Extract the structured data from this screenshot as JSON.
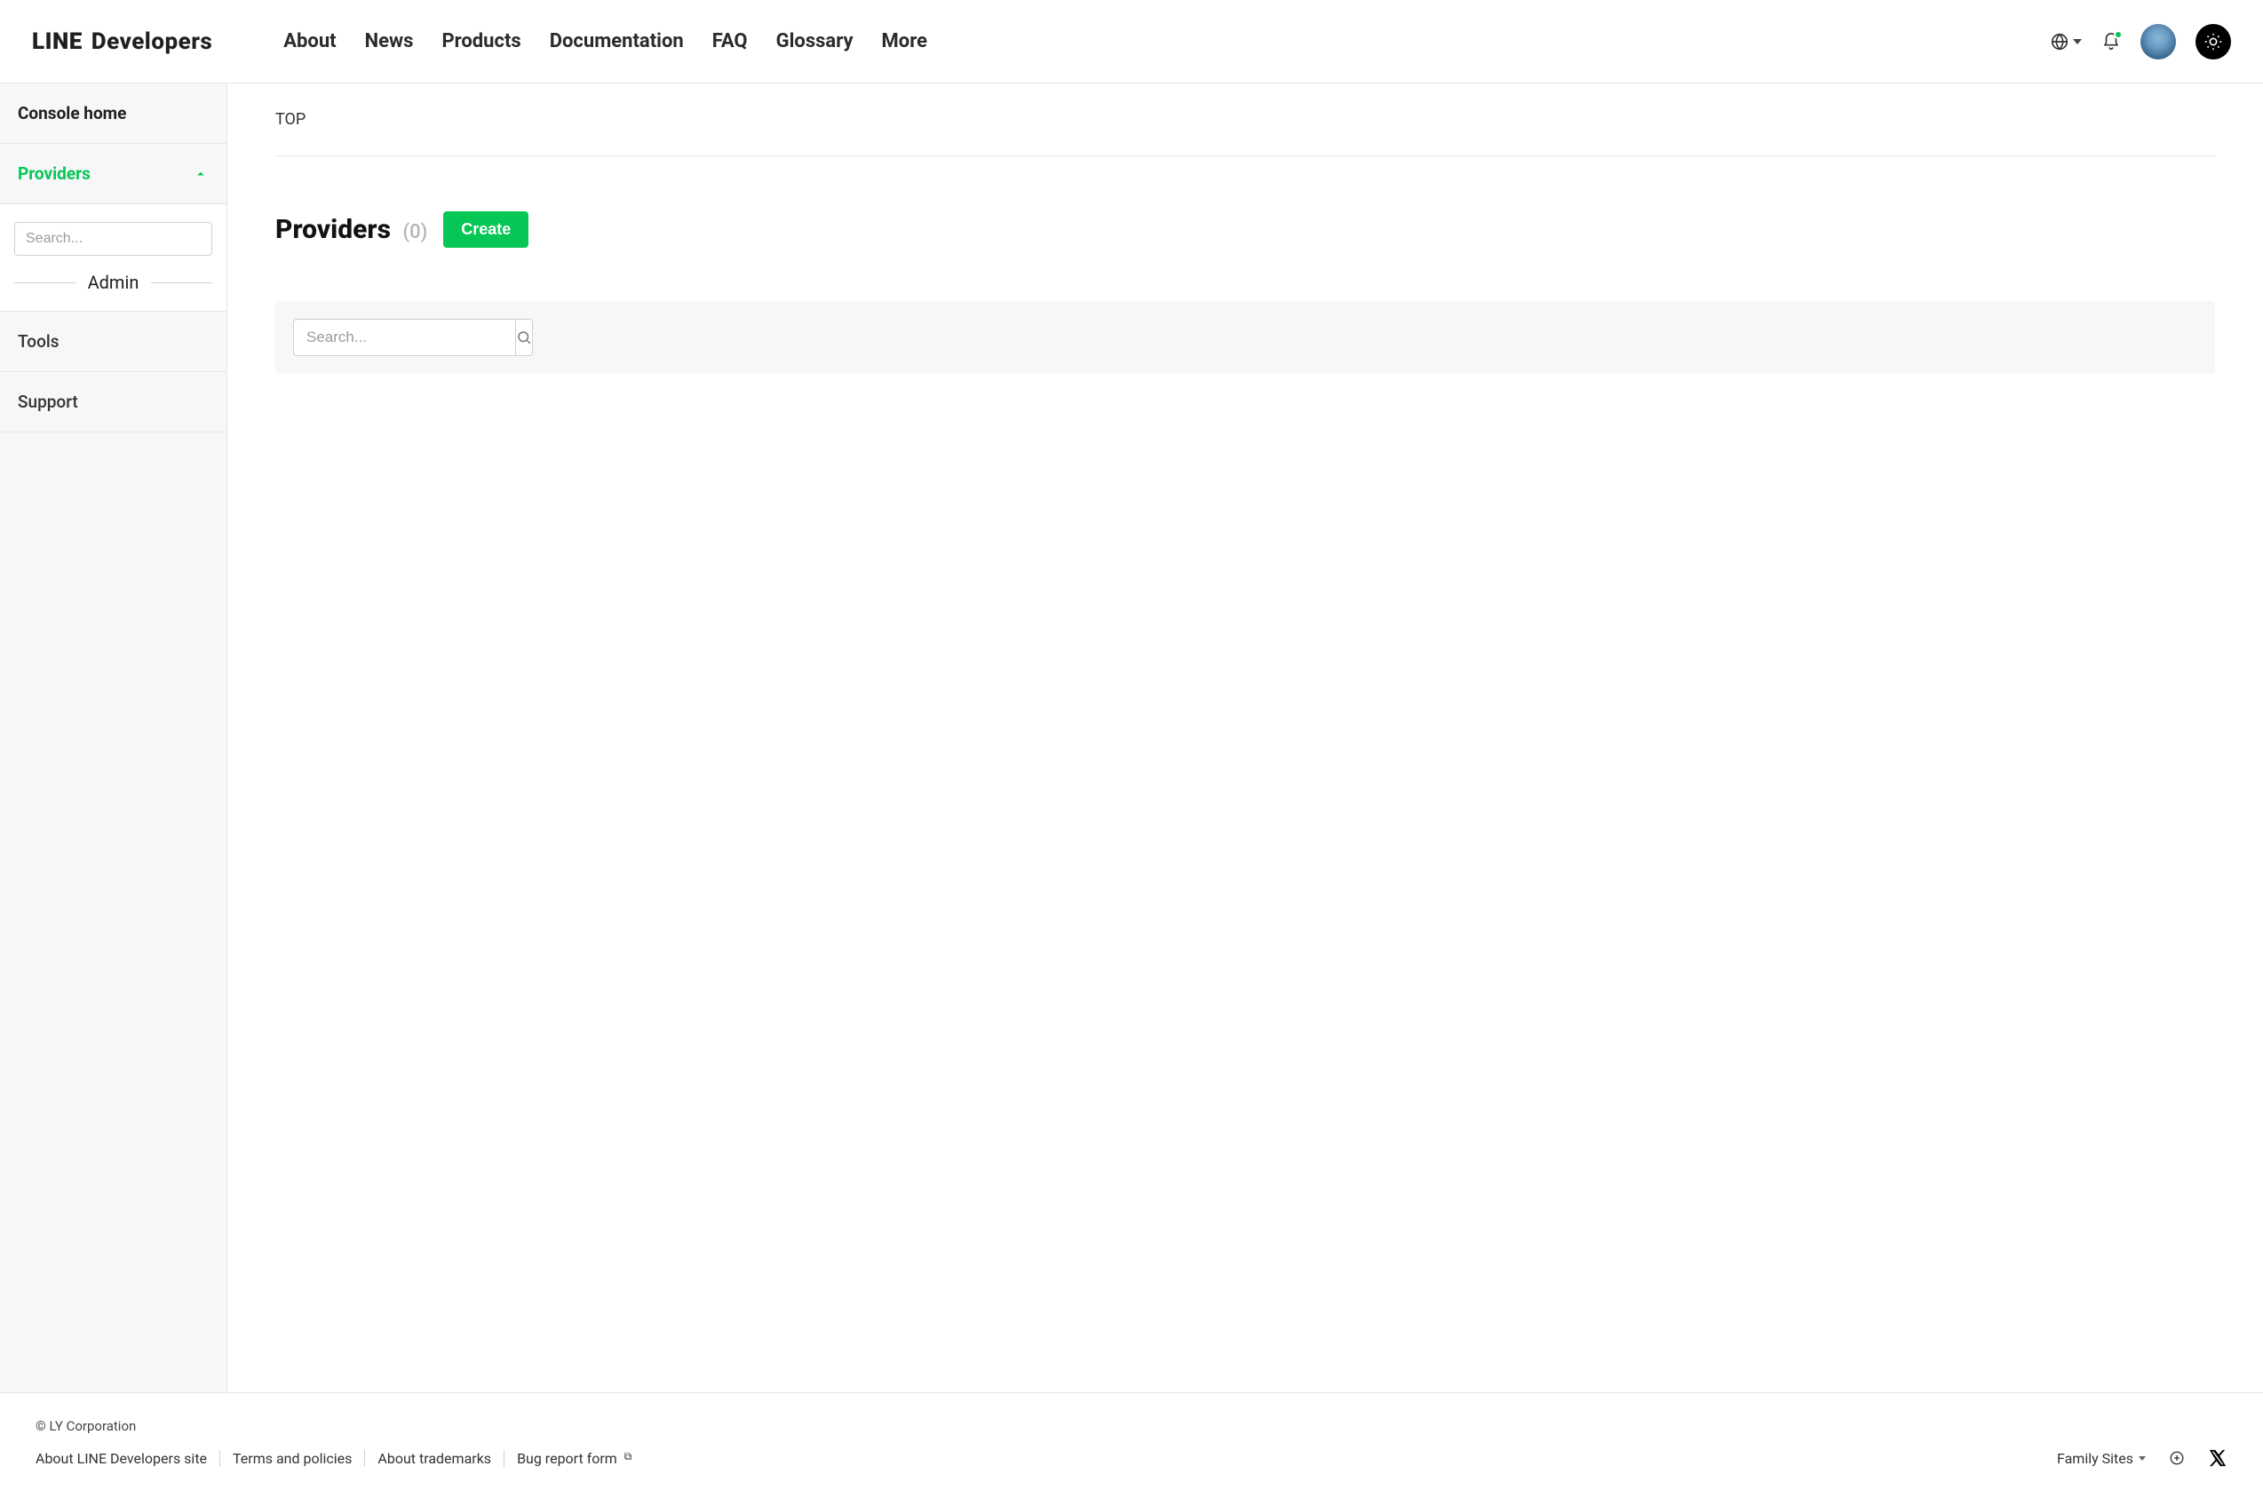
{
  "header": {
    "logo_brand": "LINE",
    "logo_sub": "Developers",
    "nav": [
      "About",
      "News",
      "Products",
      "Documentation",
      "FAQ",
      "Glossary",
      "More"
    ]
  },
  "sidebar": {
    "console_home": "Console home",
    "providers": "Providers",
    "search_placeholder": "Search...",
    "admin_label": "Admin",
    "tools": "Tools",
    "support": "Support"
  },
  "main": {
    "breadcrumb": "TOP",
    "title": "Providers",
    "count": "(0)",
    "create_label": "Create",
    "panel_search_placeholder": "Search..."
  },
  "footer": {
    "copyright": "© LY Corporation",
    "links": [
      "About LINE Developers site",
      "Terms and policies",
      "About trademarks",
      "Bug report form"
    ],
    "family_sites": "Family Sites"
  },
  "colors": {
    "accent": "#06c755"
  }
}
